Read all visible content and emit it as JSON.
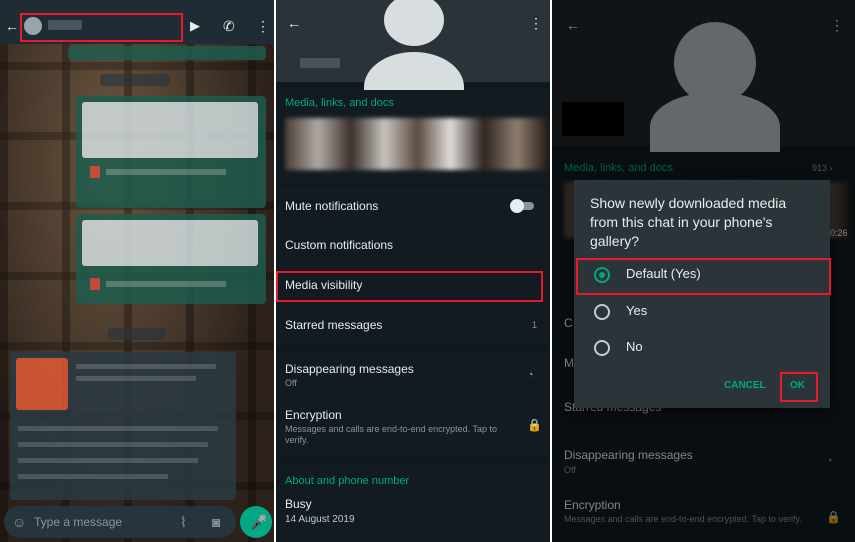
{
  "chat": {
    "header_back_icon": "arrow-left-icon",
    "contact_name": "",
    "input_placeholder": "Type a message"
  },
  "info": {
    "media_links_docs": "Media, links, and docs",
    "media_count": "913 ›",
    "mute_notifications": "Mute notifications",
    "custom_notifications": "Custom notifications",
    "media_visibility": "Media visibility",
    "starred_messages": "Starred messages",
    "starred_count": "1",
    "disappearing_messages": "Disappearing messages",
    "disappearing_value": "Off",
    "encryption": "Encryption",
    "encryption_desc": "Messages and calls are end-to-end encrypted. Tap to verify.",
    "about_phone": "About and phone number",
    "about_value": "Busy",
    "about_date": "14 August 2019",
    "video_duration": "0:26"
  },
  "dialog": {
    "title": "Show newly downloaded media from this chat in your phone's gallery?",
    "options": [
      "Default (Yes)",
      "Yes",
      "No"
    ],
    "selected": "Default (Yes)",
    "cancel_label": "CANCEL",
    "ok_label": "OK"
  },
  "colors": {
    "accent": "#00a884",
    "highlight": "#e8192c",
    "background": "#111b21"
  }
}
